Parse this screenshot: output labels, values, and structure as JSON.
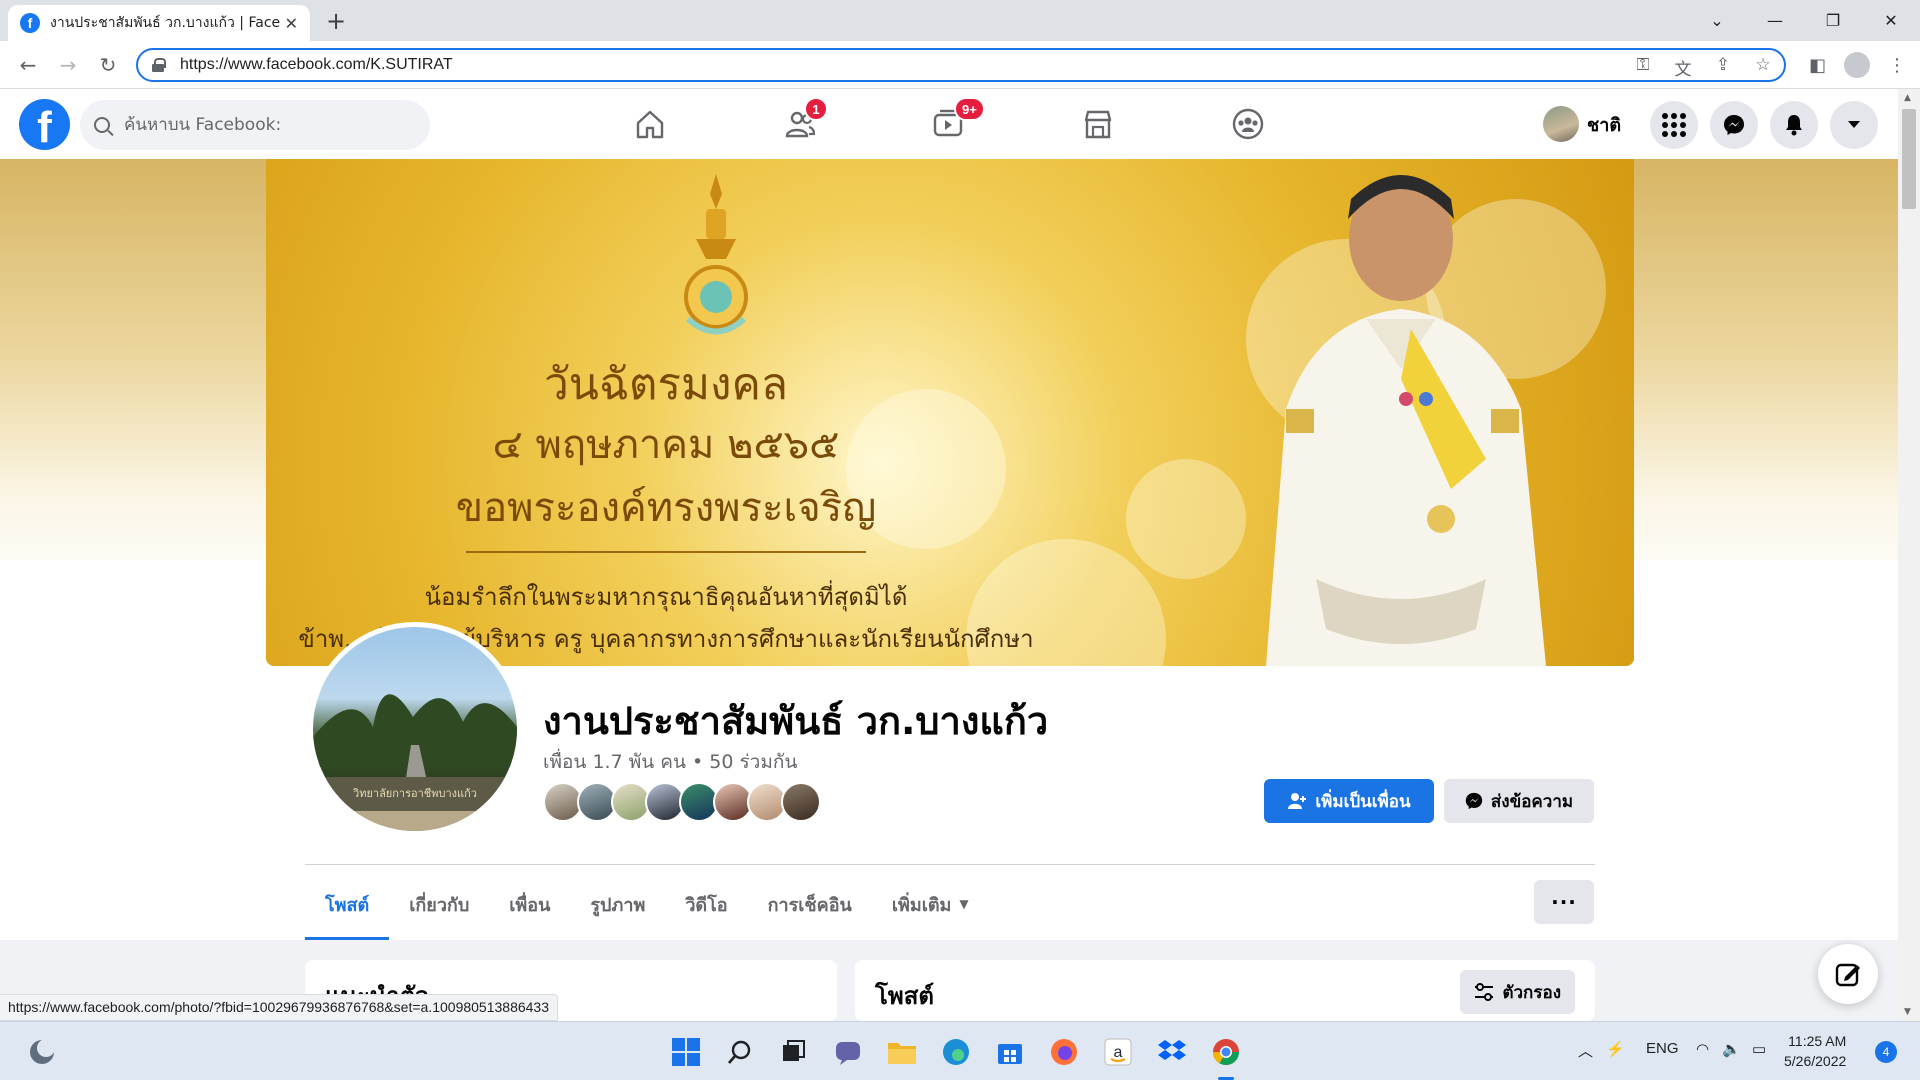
{
  "browser": {
    "tab_title": "งานประชาสัมพันธ์ วก.บางแก้ว | Faceb",
    "url": "https://www.facebook.com/K.SUTIRAT",
    "status_url": "https://www.facebook.com/photo/?fbid=10029679936876768&set=a.100980513886433"
  },
  "fb_header": {
    "logo": "f",
    "search_placeholder": "ค้นหาบน Facebook:",
    "friends_badge": "1",
    "watch_badge": "9+",
    "user_name": "ชาติ",
    "brand_color": "#1877f2",
    "badge_color": "#e41e3f"
  },
  "cover_text": {
    "line1": "วันฉัตรมงคล",
    "line2": "๔ พฤษภาคม ๒๕๖๕",
    "line3": "ขอพระองค์ทรงพระเจริญ",
    "line4": "น้อมรำลึกในพระมหากรุณาธิคุณอันหาที่สุดมิได้",
    "line5": "ข้าพ...เจ้า คณะผู้บริหาร ครู บุคลากรทางการศึกษาและนักเรียนนักศึกษา"
  },
  "avatar_sign": "วิทยาลัยการอาชีพบางแก้ว",
  "profile": {
    "name": "งานประชาสัมพันธ์ วก.บางแก้ว",
    "friends_line": "เพื่อน 1.7 พัน คน • 50 ร่วมกัน",
    "add_friend": "เพิ่มเป็นเพื่อน",
    "message": "ส่งข้อความ"
  },
  "tabs": [
    {
      "label": "โพสต์",
      "active": true
    },
    {
      "label": "เกี่ยวกับ",
      "active": false
    },
    {
      "label": "เพื่อน",
      "active": false
    },
    {
      "label": "รูปภาพ",
      "active": false
    },
    {
      "label": "วิดีโอ",
      "active": false
    },
    {
      "label": "การเช็คอิน",
      "active": false
    },
    {
      "label": "เพิ่มเติม",
      "active": false
    }
  ],
  "more_dots": "···",
  "intro_title": "แนะนำตัว",
  "posts_title": "โพสต์",
  "filter_label": "ตัวกรอง",
  "taskbar": {
    "lang": "ENG",
    "time": "11:25 AM",
    "date": "5/26/2022",
    "notifications": "4"
  }
}
